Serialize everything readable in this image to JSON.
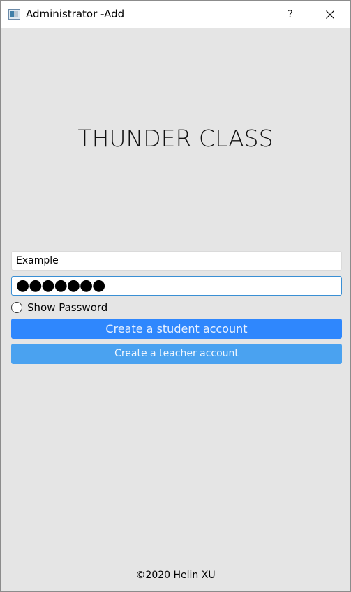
{
  "window": {
    "title": "Administrator -Add",
    "help_label": "?",
    "app_icon": "window-app-icon",
    "close_icon": "close-icon"
  },
  "brand": {
    "title": "THUNDER CLASS"
  },
  "form": {
    "username_value": "Example",
    "password_masked": "●●●●●●●",
    "show_password_label": "Show Password",
    "show_password_checked": false,
    "create_student_label": "Create a student account",
    "create_teacher_label": "Create a teacher account"
  },
  "colors": {
    "student_button": "#2f87fd",
    "teacher_button": "#4aa2f0",
    "background": "#e5e5e5",
    "focus_border": "#3a8fd4"
  },
  "footer": {
    "copyright": "©2020 Helin XU"
  }
}
